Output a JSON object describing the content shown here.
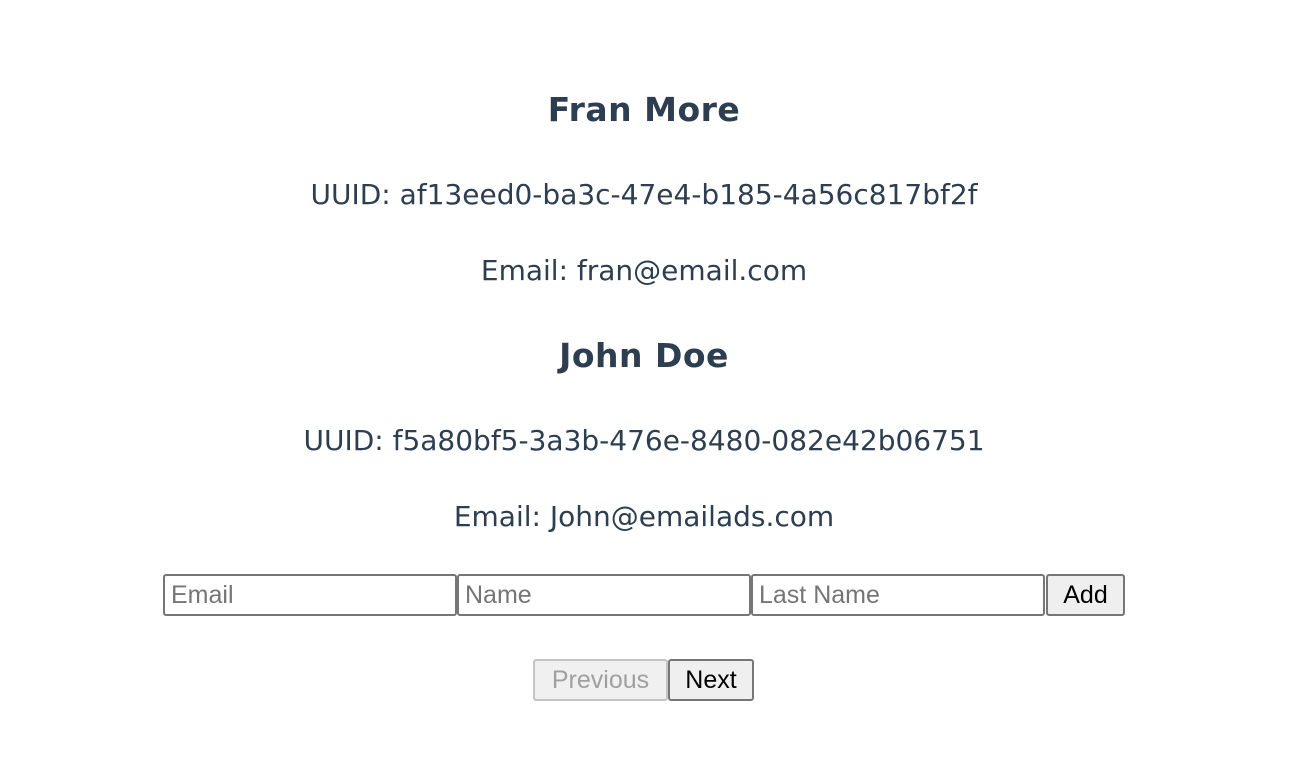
{
  "users": [
    {
      "name": "Fran More",
      "uuid_line": "UUID: af13eed0-ba3c-47e4-b185-4a56c817bf2f",
      "email_line": "Email: fran@email.com"
    },
    {
      "name": "John Doe",
      "uuid_line": "UUID: f5a80bf5-3a3b-476e-8480-082e42b06751",
      "email_line": "Email: John@emailads.com"
    }
  ],
  "form": {
    "email": {
      "value": "",
      "placeholder": "Email"
    },
    "name": {
      "value": "",
      "placeholder": "Name"
    },
    "last_name": {
      "value": "",
      "placeholder": "Last Name"
    },
    "add_label": "Add"
  },
  "pagination": {
    "previous_label": "Previous",
    "previous_disabled": true,
    "next_label": "Next"
  },
  "colors": {
    "text": "#2c3e50",
    "button_bg": "#efefef",
    "disabled_text": "#a0a0a0"
  }
}
